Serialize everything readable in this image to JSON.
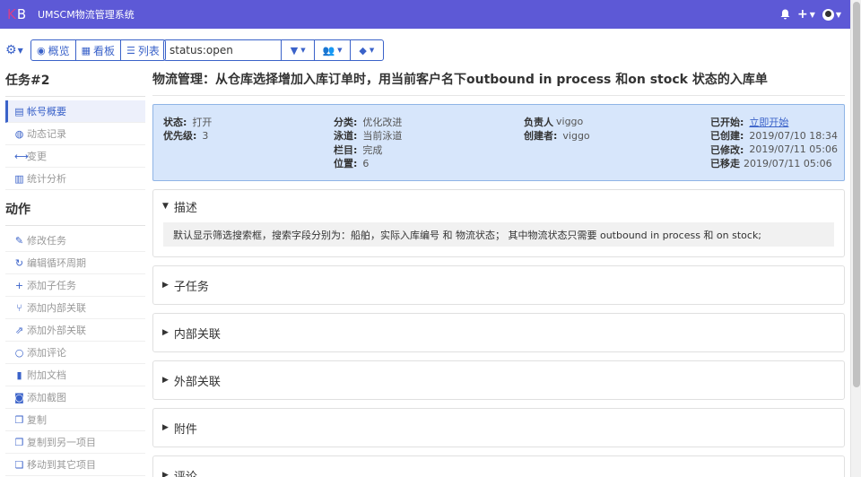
{
  "header": {
    "logo_k": "K",
    "logo_b": "B",
    "title": "UMSCM物流管理系统",
    "icons": [
      "bell-icon",
      "plus-icon",
      "user-avatar-icon"
    ]
  },
  "toolbar": {
    "overview_label": "概览",
    "board_label": "看板",
    "list_label": "列表",
    "search_value": "status:open"
  },
  "sidebar": {
    "task_heading": "任务#2",
    "task_items": [
      {
        "label": "帐号概要",
        "icon": "overview-icon",
        "active": true
      },
      {
        "label": "动态记录",
        "icon": "dashboard-icon"
      },
      {
        "label": "变更",
        "icon": "arrows-icon"
      },
      {
        "label": "统计分析",
        "icon": "bar-chart-icon"
      }
    ],
    "action_heading": "动作",
    "action_items": [
      {
        "label": "修改任务",
        "icon": "edit-icon"
      },
      {
        "label": "编辑循环周期",
        "icon": "refresh-icon"
      },
      {
        "label": "添加子任务",
        "icon": "plus-icon"
      },
      {
        "label": "添加内部关联",
        "icon": "code-fork-icon"
      },
      {
        "label": "添加外部关联",
        "icon": "external-link-icon"
      },
      {
        "label": "添加评论",
        "icon": "comment-icon"
      },
      {
        "label": "附加文档",
        "icon": "file-icon"
      },
      {
        "label": "添加截图",
        "icon": "camera-icon"
      },
      {
        "label": "复制",
        "icon": "copy-icon"
      },
      {
        "label": "复制到另一项目",
        "icon": "copy-project-icon"
      },
      {
        "label": "移动到其它项目",
        "icon": "move-icon"
      }
    ]
  },
  "main": {
    "title": "物流管理：从仓库选择增加入库订单时，用当前客户名下outbound in process 和on stock 状态的入库单",
    "summary": {
      "status_label": "状态:",
      "status_value": "打开",
      "priority_label": "优先级:",
      "priority_value": "3",
      "category_label": "分类:",
      "category_value": "优化改进",
      "swimlane_label": "泳道:",
      "swimlane_value": "当前泳道",
      "column_label": "栏目:",
      "column_value": "完成",
      "position_label": "位置:",
      "position_value": "6",
      "assignee_label": "负责人",
      "assignee_value": "viggo",
      "creator_label": "创建者:",
      "creator_value": "viggo",
      "started_label": "已开始:",
      "started_value": "立即开始",
      "created_label": "已创建:",
      "created_value": "2019/07/10 18:34",
      "modified_label": "已修改:",
      "modified_value": "2019/07/11 05:06",
      "moved_label": "已移走",
      "moved_value": "2019/07/11 05:06"
    },
    "description": {
      "title": "描述",
      "text": "默认显示筛选搜索框，搜索字段分别为：船舶，实际入库编号 和 物流状态； 其中物流状态只需要 outbound in process 和 on stock;"
    },
    "panels": [
      "子任务",
      "内部关联",
      "外部关联",
      "附件",
      "评论"
    ]
  }
}
